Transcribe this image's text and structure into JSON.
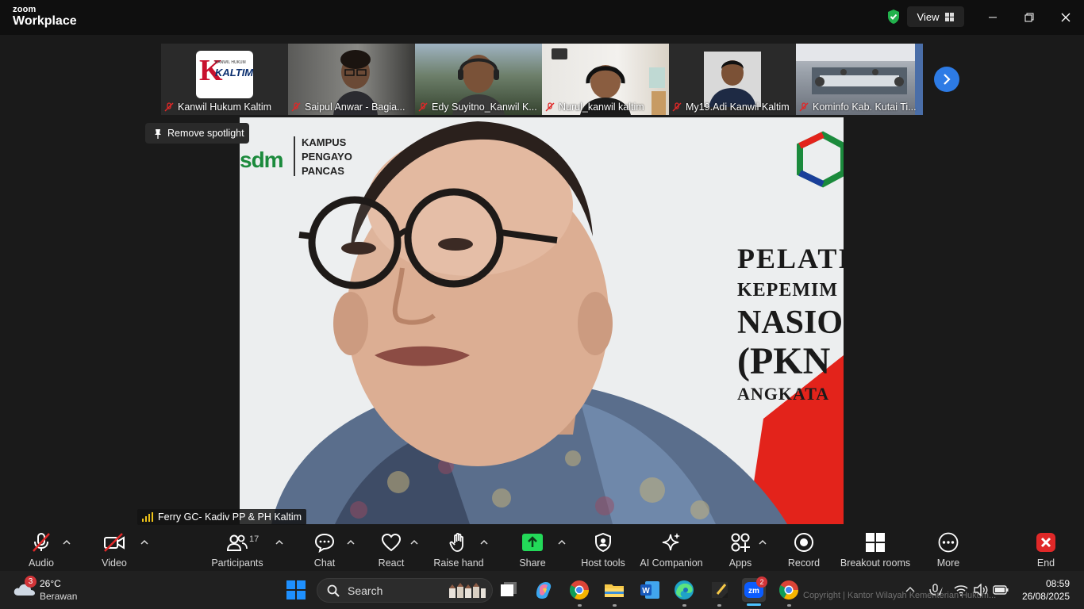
{
  "window": {
    "brand_small": "zoom",
    "brand_big": "Workplace",
    "view_label": "View"
  },
  "participants_strip": [
    {
      "name": "Kanwil Hukum Kaltim"
    },
    {
      "name": "Saipul Anwar - Bagia..."
    },
    {
      "name": "Edy Suyitno_Kanwil K..."
    },
    {
      "name": "Nurul_kanwil kaltim"
    },
    {
      "name": "My19.Adi Kanwil Kaltim"
    },
    {
      "name": "Kominfo Kab. Kutai Ti..."
    }
  ],
  "kaltim_logo": {
    "top": "KANWIL HUKUM",
    "bottom": "KALTIM"
  },
  "spotlight_label": "Remove spotlight",
  "main_video": {
    "speaker": "Ferry GC- Kadiv PP & PH Kaltim",
    "backdrop_logo": "sdm",
    "backdrop_campus": [
      "KAMPUS",
      "PENGAYO",
      "PANCAS"
    ],
    "backdrop_banner": [
      "PELATI",
      "KEPEMIM",
      "NASIO",
      "(PKN",
      "ANGKATA"
    ]
  },
  "toolbar": {
    "audio": "Audio",
    "video": "Video",
    "participants": "Participants",
    "participants_count": "17",
    "chat": "Chat",
    "react": "React",
    "raise_hand": "Raise hand",
    "share": "Share",
    "host_tools": "Host tools",
    "ai_companion": "AI Companion",
    "apps": "Apps",
    "record": "Record",
    "breakout_rooms": "Breakout rooms",
    "more": "More",
    "end": "End"
  },
  "taskbar": {
    "weather_badge": "3",
    "temperature": "26°C",
    "weather_desc": "Berawan",
    "search_label": "Search",
    "zoom_badge": "2",
    "time": "08:59",
    "date": "26/08/2025",
    "watermark": "Copyright | Kantor Wilayah Kementerian Hukum..."
  },
  "colors": {
    "accent_blue": "#2d7be5",
    "share_green": "#23d959",
    "end_red": "#e02828",
    "mic_red": "#e02828"
  }
}
